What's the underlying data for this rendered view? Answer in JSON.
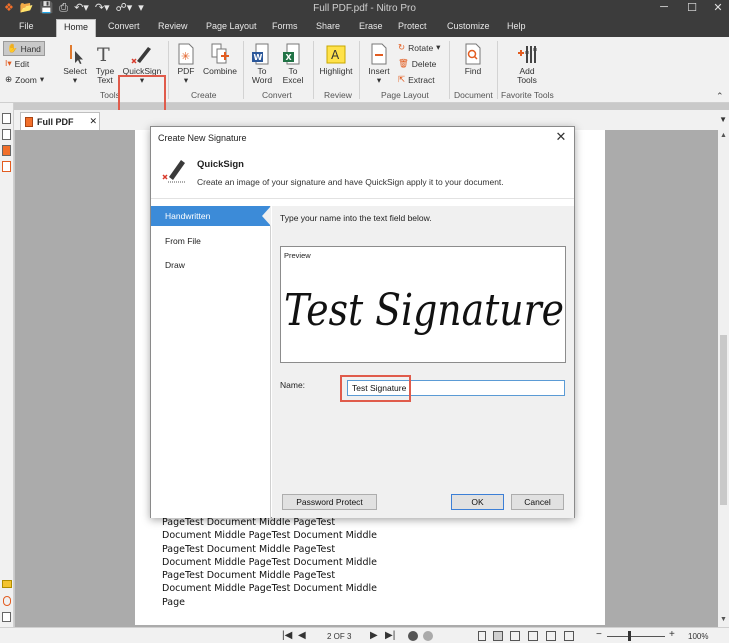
{
  "window": {
    "title": "Full PDF.pdf - Nitro Pro",
    "quick_access": [
      "nitro-logo-icon",
      "open-folder-icon",
      "save-icon",
      "print-icon",
      "undo-icon",
      "redo-icon",
      "pointer-icon",
      "customize-icon"
    ]
  },
  "tabs": [
    "File",
    "Home",
    "Convert",
    "Review",
    "Page Layout",
    "Forms",
    "Share",
    "Erase",
    "Protect",
    "Customize",
    "Help"
  ],
  "active_tab": "Home",
  "ribbon": {
    "hand": "Hand",
    "edit": "Edit",
    "zoom": "Zoom",
    "select": "Select",
    "type_text_1": "Type",
    "type_text_2": "Text",
    "quicksign": "QuickSign",
    "pdf": "PDF",
    "combine": "Combine",
    "to_word_1": "To",
    "to_word_2": "Word",
    "to_excel_1": "To",
    "to_excel_2": "Excel",
    "highlight": "Highlight",
    "insert": "Insert",
    "rotate": "Rotate",
    "delete": "Delete",
    "extract": "Extract",
    "find": "Find",
    "add_tools_1": "Add",
    "add_tools_2": "Tools",
    "groups": {
      "tools": "Tools",
      "create": "Create",
      "convert": "Convert",
      "review": "Review",
      "page_layout": "Page Layout",
      "document": "Document",
      "favorite_tools": "Favorite Tools"
    }
  },
  "document_tab": "Full PDF",
  "page_text": [
    "PageTest Document Middle PageTest",
    "Document Middle PageTest Document Middle",
    "PageTest Document Middle PageTest",
    "Document Middle PageTest Document Middle",
    "PageTest Document Middle PageTest",
    "Document Middle PageTest Document Middle",
    "Page"
  ],
  "status": {
    "page": "2 OF 3",
    "zoom": "100%"
  },
  "dialog": {
    "title": "Create New Signature",
    "header_title": "QuickSign",
    "header_desc": "Create an image of your signature and have QuickSign apply it to your document.",
    "nav": [
      "Handwritten",
      "From File",
      "Draw"
    ],
    "instruction": "Type your name into the text field below.",
    "preview_label": "Preview",
    "signature_text": "Test Signature",
    "name_label": "Name:",
    "name_value": "Test Signature",
    "password_button": "Password Protect",
    "ok_button": "OK",
    "cancel_button": "Cancel"
  },
  "colors": {
    "accent": "#3c8bd8",
    "highlight_box": "#e05b4b",
    "titlebar": "#3c3c3c"
  }
}
